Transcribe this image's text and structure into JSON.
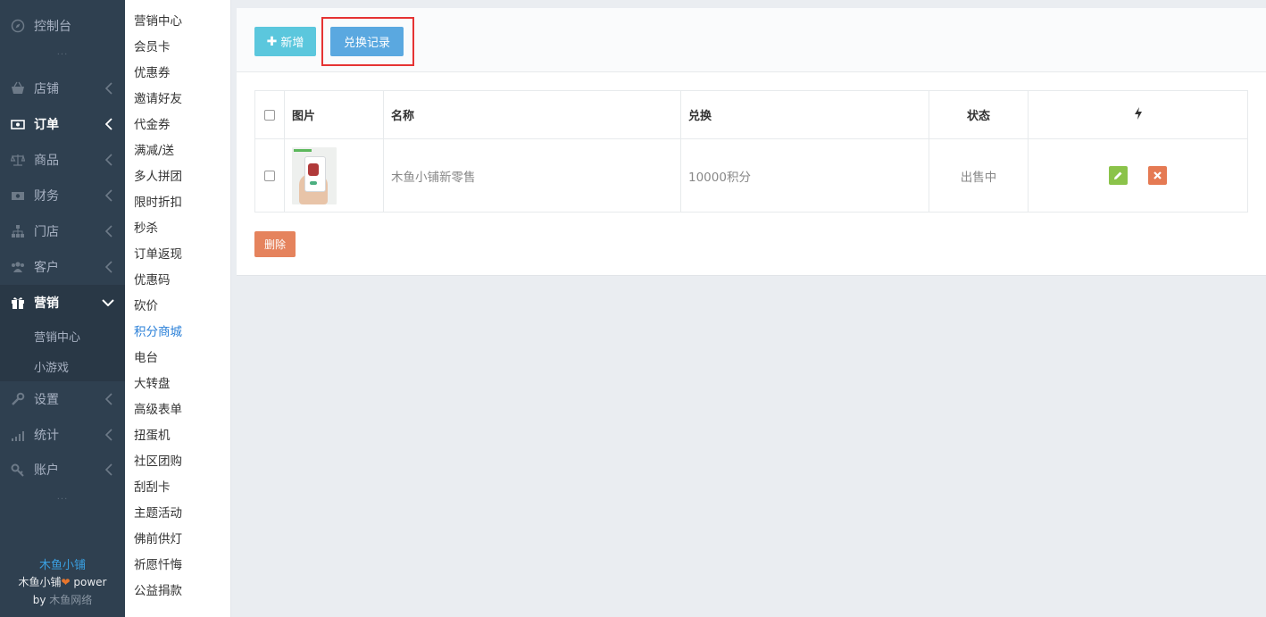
{
  "sidebar": {
    "console": "控制台",
    "dots": "···",
    "items": [
      {
        "label": "店铺",
        "icon": "basket-icon"
      },
      {
        "label": "订单",
        "icon": "money-icon"
      },
      {
        "label": "商品",
        "icon": "scale-icon"
      },
      {
        "label": "财务",
        "icon": "cash-icon"
      },
      {
        "label": "门店",
        "icon": "sitemap-icon"
      },
      {
        "label": "客户",
        "icon": "users-icon"
      },
      {
        "label": "营销",
        "icon": "gift-icon"
      },
      {
        "label": "设置",
        "icon": "wrench-icon"
      },
      {
        "label": "统计",
        "icon": "signal-icon"
      },
      {
        "label": "账户",
        "icon": "key-icon"
      }
    ],
    "sub_items": [
      "营销中心",
      "小游戏"
    ],
    "footer": {
      "brand": "木鱼小铺",
      "line2_a": "木鱼小铺",
      "line2_b": " power",
      "line3_a": "by ",
      "line3_b": "木鱼网络"
    }
  },
  "submenu": {
    "items": [
      "营销中心",
      "会员卡",
      "优惠券",
      "邀请好友",
      "代金券",
      "满减/送",
      "多人拼团",
      "限时折扣",
      "秒杀",
      "订单返现",
      "优惠码",
      "砍价",
      "积分商城",
      "电台",
      "大转盘",
      "高级表单",
      "扭蛋机",
      "社区团购",
      "刮刮卡",
      "主题活动",
      "佛前供灯",
      "祈愿忏悔",
      "公益捐款"
    ],
    "current_index": 12
  },
  "toolbar": {
    "add_label": "新增",
    "add_plus": "✚",
    "record_label": "兑换记录"
  },
  "table": {
    "headers": {
      "image": "图片",
      "name": "名称",
      "exchange": "兑换",
      "status": "状态"
    },
    "rows": [
      {
        "name": "木鱼小铺新零售",
        "exchange": "10000积分",
        "status": "出售中"
      }
    ]
  },
  "actions": {
    "delete_label": "删除"
  },
  "colors": {
    "sidebar": "#2f4050",
    "accent": "#2b80d8",
    "add": "#5bc7dd",
    "record": "#5aa8e0",
    "edit": "#8bc34a",
    "del": "#e57a53",
    "highlight": "#e53333"
  }
}
